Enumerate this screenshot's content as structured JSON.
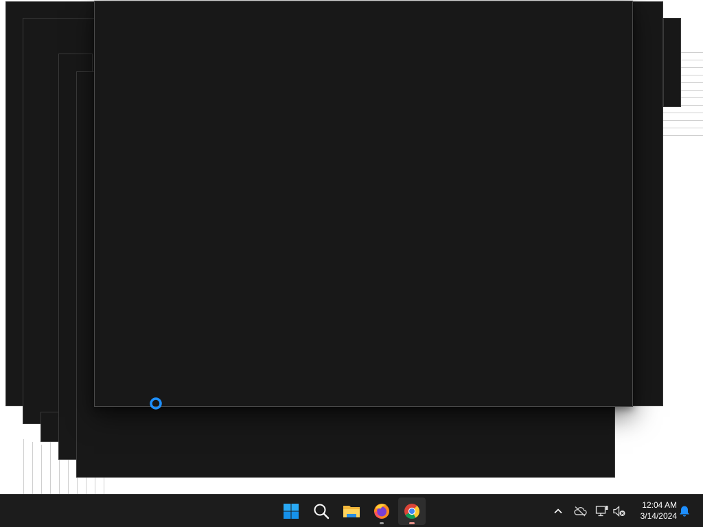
{
  "taskbar": {
    "apps": [
      {
        "name": "Start",
        "icon": "windows-start-icon"
      },
      {
        "name": "Search",
        "icon": "search-icon"
      },
      {
        "name": "File Explorer",
        "icon": "folder-icon"
      },
      {
        "name": "Firefox",
        "icon": "firefox-icon",
        "running": true
      },
      {
        "name": "Google Chrome",
        "icon": "chrome-icon",
        "running": true,
        "active": true
      }
    ],
    "tray": {
      "icons": [
        "chevron-up-icon",
        "onedrive-offline-icon",
        "network-disconnected-icon",
        "volume-muted-icon",
        "notification-bell-icon"
      ]
    },
    "clock": {
      "time": "12:04 AM",
      "date": "3/14/2024"
    }
  },
  "colors": {
    "window_bg": "#181818",
    "taskbar_bg": "#1c1c1c",
    "accent": "#0078d4",
    "busy_cursor": "#1e90ff"
  }
}
